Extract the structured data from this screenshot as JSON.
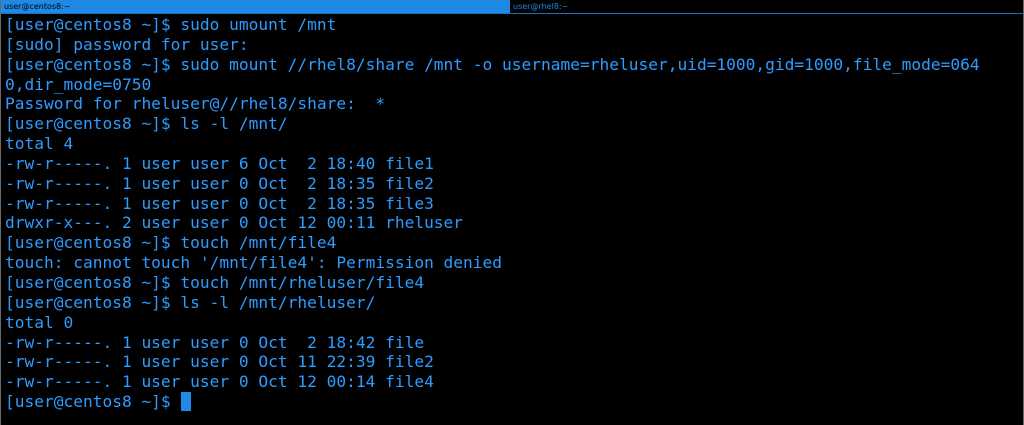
{
  "tabs": [
    {
      "label": "user@centos8:~",
      "active": true
    },
    {
      "label": "user@rhel8:~",
      "active": false
    }
  ],
  "terminal": {
    "lines": [
      "[user@centos8 ~]$ sudo umount /mnt",
      "[sudo] password for user:",
      "[user@centos8 ~]$ sudo mount //rhel8/share /mnt -o username=rheluser,uid=1000,gid=1000,file_mode=064",
      "0,dir_mode=0750",
      "Password for rheluser@//rhel8/share:  *",
      "[user@centos8 ~]$ ls -l /mnt/",
      "total 4",
      "-rw-r-----. 1 user user 6 Oct  2 18:40 file1",
      "-rw-r-----. 1 user user 0 Oct  2 18:35 file2",
      "-rw-r-----. 1 user user 0 Oct  2 18:35 file3",
      "drwxr-x---. 2 user user 0 Oct 12 00:11 rheluser",
      "[user@centos8 ~]$ touch /mnt/file4",
      "touch: cannot touch '/mnt/file4': Permission denied",
      "[user@centos8 ~]$ touch /mnt/rheluser/file4",
      "[user@centos8 ~]$ ls -l /mnt/rheluser/",
      "total 0",
      "-rw-r-----. 1 user user 0 Oct  2 18:42 file",
      "-rw-r-----. 1 user user 0 Oct 11 22:39 file2",
      "-rw-r-----. 1 user user 0 Oct 12 00:14 file4"
    ],
    "prompt": "[user@centos8 ~]$ "
  },
  "colors": {
    "background": "#000000",
    "text": "#2e9bff",
    "active_tab": "#1f8ae6"
  }
}
